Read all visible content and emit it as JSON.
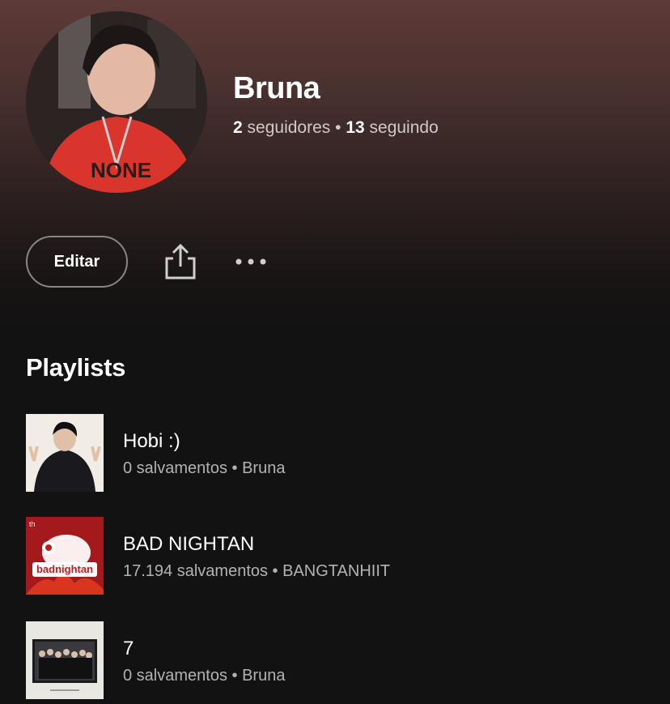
{
  "profile": {
    "name": "Bruna",
    "followers_count": "2",
    "followers_label": "seguidores",
    "separator": "•",
    "following_count": "13",
    "following_label": "seguindo",
    "avatar_icon": "profile-photo"
  },
  "actions": {
    "edit_label": "Editar",
    "share_icon": "share-icon",
    "more_icon": "more-options-icon"
  },
  "playlists": {
    "section_title": "Playlists",
    "items": [
      {
        "title": "Hobi :)",
        "meta": "0 salvamentos • Bruna"
      },
      {
        "title": "BAD NIGHTAN",
        "meta": "17.194 salvamentos • BANGTANHIIT",
        "cover_text": "badnightan",
        "cover_badge": "th"
      },
      {
        "title": "7",
        "meta": "0 salvamentos • Bruna"
      }
    ]
  },
  "colors": {
    "header_gradient_top": "#5d3a37",
    "background": "#121212",
    "text_primary": "#ffffff",
    "text_secondary": "#b3b3b3",
    "cover2_red": "#a3191c"
  }
}
